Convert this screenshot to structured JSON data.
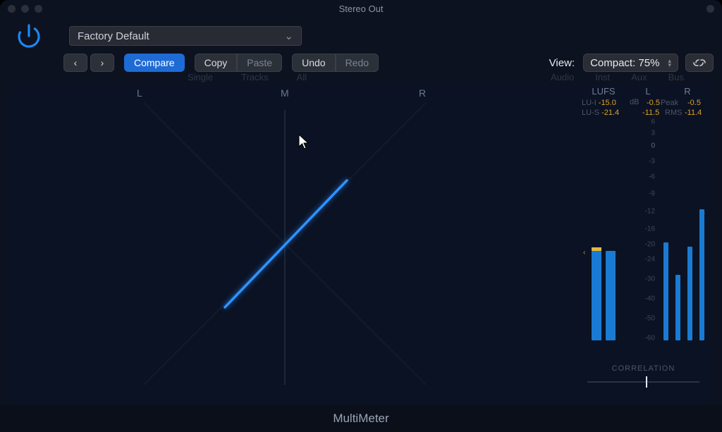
{
  "window": {
    "title": "Stereo Out"
  },
  "preset": {
    "label": "Factory Default"
  },
  "toolbar": {
    "compare": "Compare",
    "copy": "Copy",
    "paste": "Paste",
    "undo": "Undo",
    "redo": "Redo",
    "view_label": "View:",
    "view_value": "Compact: 75%"
  },
  "ghost": {
    "single": "Single",
    "tracks": "Tracks",
    "all": "All",
    "audio": "Audio",
    "inst": "Inst",
    "aux": "Aux",
    "bus": "Bus"
  },
  "gono": {
    "L": "L",
    "M": "M",
    "R": "R"
  },
  "meters": {
    "head": {
      "lufs": "LUFS",
      "L": "L",
      "R": "R"
    },
    "lu_i_key": "LU-I",
    "lu_i": "-15.0",
    "lu_s_key": "LU-S",
    "lu_s": "-21.4",
    "db": "dB",
    "peak_key": "Peak",
    "peak_l": "-0.5",
    "peak_r": "-0.5",
    "rms_key": "RMS",
    "rms_l": "-11.5",
    "rms_r": "-11.4",
    "scale_ticks": [
      "6",
      "3",
      "0",
      "-3",
      "-6",
      "-9",
      "-12",
      "-16",
      "-20",
      "-24",
      "-30",
      "-40",
      "-50",
      "-60"
    ],
    "corr": "CORRELATION"
  },
  "footer": {
    "name": "MultiMeter"
  },
  "chart_data": {
    "meter_scale": {
      "min": -60,
      "max": 6,
      "ticks": [
        6,
        3,
        0,
        -3,
        -6,
        -9,
        -12,
        -16,
        -20,
        -24,
        -30,
        -40,
        -50,
        -60
      ]
    },
    "lufs": {
      "integrated": -15.0,
      "short_term": -21.4,
      "marker_db": -22
    },
    "lufs_bars": {
      "LU_I": {
        "top_db": -22,
        "over_cap": true
      },
      "LU_S": {
        "top_db": -22
      }
    },
    "peak": {
      "L": -0.5,
      "R": -0.5
    },
    "rms": {
      "L": -11.5,
      "R": -11.4
    },
    "lr_bars": {
      "peak_L": {
        "top_db": -20
      },
      "peak_R": {
        "top_db": -12
      },
      "rms_L": {
        "top_db": -28
      },
      "rms_R": {
        "top_db": -21
      }
    },
    "right_marker_db": -12,
    "correlation": 0.05,
    "goniometer": {
      "angle_deg": 45,
      "intensity": 0.55
    }
  }
}
